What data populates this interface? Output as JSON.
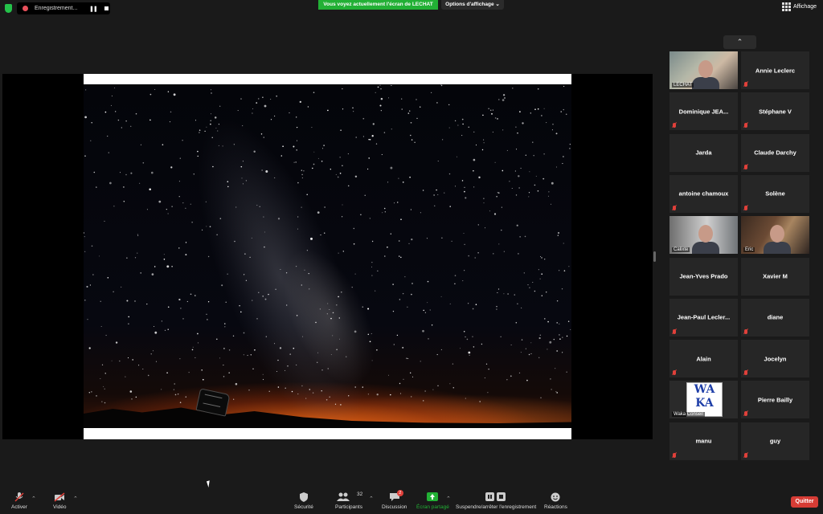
{
  "topbar": {
    "recording_label": "Enregistrement...",
    "pause_glyph": "❚❚",
    "share_banner": "Vous voyez actuellement l'écran de LECHAT",
    "view_options": "Options d'affichage ⌄",
    "view_label": "Affichage"
  },
  "panel": {
    "collapse_glyph": "⌃"
  },
  "participants": [
    {
      "name": "LECHAT",
      "video": true,
      "active": true
    },
    {
      "name": "Annie Leclerc",
      "video": false,
      "muted": true
    },
    {
      "name": "Dominique  JEA...",
      "video": false,
      "muted": true
    },
    {
      "name": "Stéphane V",
      "video": false,
      "muted": true
    },
    {
      "name": "Jarda",
      "video": false,
      "muted": false
    },
    {
      "name": "Claude Darchy",
      "video": false,
      "muted": true
    },
    {
      "name": "antoine chamoux",
      "video": false,
      "muted": true
    },
    {
      "name": "Solène",
      "video": false,
      "muted": true
    },
    {
      "name": "Calixte",
      "video": true
    },
    {
      "name": "Eric",
      "video": true
    },
    {
      "name": "Jean-Yves Prado",
      "video": false,
      "muted": false
    },
    {
      "name": "Xavier M",
      "video": false,
      "muted": false
    },
    {
      "name": "Jean-Paul  Lecler...",
      "video": false,
      "muted": true
    },
    {
      "name": "diane",
      "video": false,
      "muted": true
    },
    {
      "name": "Alain",
      "video": false,
      "muted": true
    },
    {
      "name": "Jocelyn",
      "video": false,
      "muted": true
    },
    {
      "name": "Waka Conseil",
      "video": true,
      "logo": "WA KA"
    },
    {
      "name": "Pierre Bailly",
      "video": false,
      "muted": true
    },
    {
      "name": "manu",
      "video": false,
      "muted": true
    },
    {
      "name": "guy",
      "video": false,
      "muted": true
    }
  ],
  "toolbar": {
    "activer": "Activer",
    "video": "Vidéo",
    "securite": "Sécurité",
    "participants": "Participants",
    "participants_count": "32",
    "discussion": "Discussion",
    "discussion_badge": "2",
    "ecran_partage": "Écran partagé",
    "suspendre": "Suspendre/arrêter l'enregistrement",
    "reactions": "Réactions",
    "quitter": "Quitter"
  },
  "colors": {
    "share_green": "#22b035",
    "quit_red": "#d63c35",
    "active_outline": "#b6e04a",
    "muted_red": "#e0403a"
  }
}
